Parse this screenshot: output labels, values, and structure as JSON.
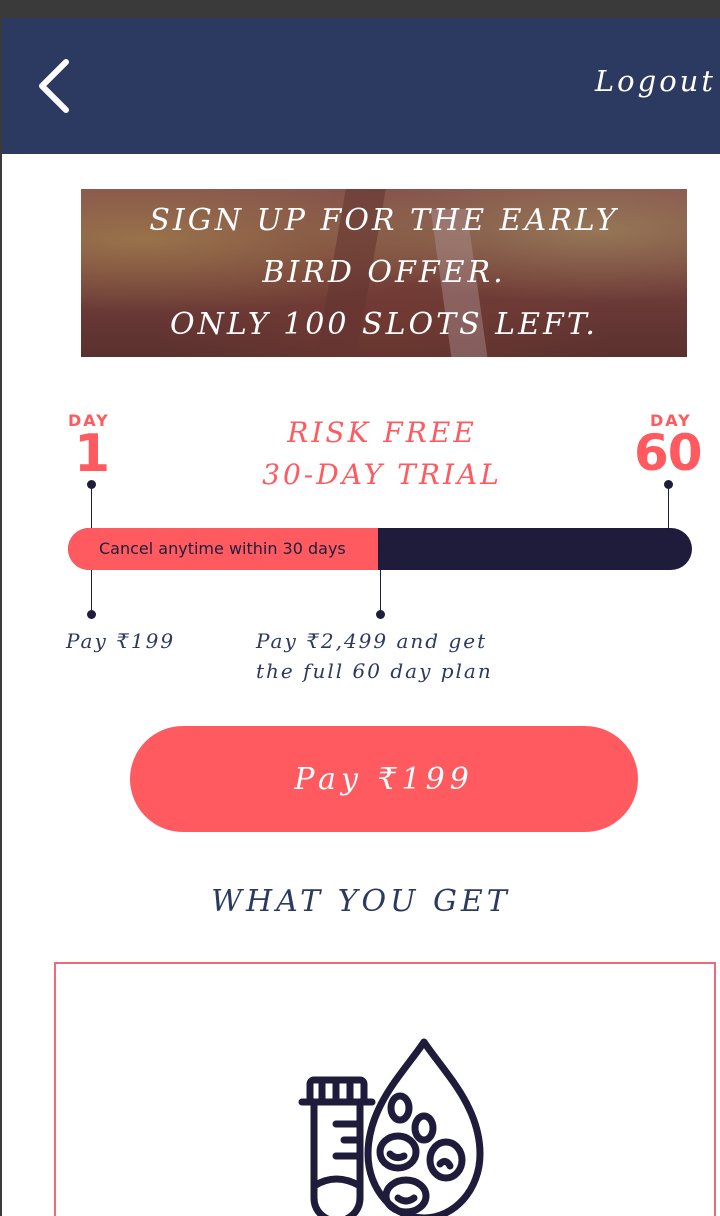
{
  "header": {
    "logout_label": "Logout",
    "back_icon": "chevron-left-icon"
  },
  "banner": {
    "line1": "SIGN UP FOR THE EARLY",
    "line2": "BIRD OFFER.",
    "line3": "ONLY 100 SLOTS LEFT."
  },
  "timeline": {
    "start_label": "DAY",
    "start_day": "1",
    "end_label": "DAY",
    "end_day": "60",
    "trial_line1": "RISK FREE",
    "trial_line2": "30-DAY TRIAL",
    "bar_text": "Cancel anytime within 30 days",
    "trial_fraction": 0.5,
    "pay_start": "Pay ₹199",
    "pay_mid_line1": "Pay ₹2,499 and get",
    "pay_mid_line2": "the full 60 day plan"
  },
  "cta": {
    "pay_label": "Pay ₹199"
  },
  "section": {
    "title": "WHAT YOU GET",
    "card_icon": "blood-test-icon"
  },
  "colors": {
    "header_bg": "#2c3a62",
    "accent": "#ff5a5f",
    "dark": "#1e1c3a"
  }
}
